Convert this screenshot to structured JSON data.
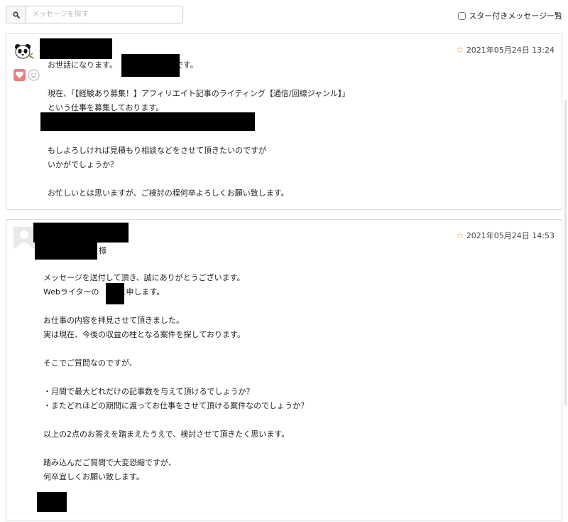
{
  "search": {
    "placeholder": "メッセージを探す"
  },
  "starred_filter": {
    "label": "スター付きメッセージ一覧"
  },
  "messages": [
    {
      "timestamp": "2021年05月24日 13:24",
      "greeting_prefix": "お世話になります。",
      "greeting_suffix": "です。",
      "lines": [
        "現在、「【経験あり募集！】アフィリエイト記事のライティング【通信/回線ジャンル】」",
        "という仕事を募集しております。",
        "",
        "",
        "もしよろしければ見積もり相談などをさせて頂きたいのですが",
        "いかがでしょうか？",
        "",
        "お忙しいとは思いますが、ご検討の程何卒よろしくお願い致します。"
      ]
    },
    {
      "timestamp": "2021年05月24日 14:53",
      "salutation_suffix": "様",
      "intro_line1": "メッセージを送付して頂き、誠にありがとうございます。",
      "intro_line2_prefix": "Webライターの",
      "intro_line2_suffix": "と申します。",
      "lines": [
        "",
        "お仕事の内容を拝見させて頂きました。",
        "実は現在、今後の収益の柱となる案件を探しております。",
        "",
        "そこでご質問なのですが、",
        "",
        "・月間で最大どれだけの記事数を与えて頂けるでしょうか？",
        "・またどれほどの期間に渡ってお仕事をさせて頂ける案件なのでしょうか？",
        "",
        "以上の2点のお答えを踏まえたうえで、検討させて頂きたく思います。",
        "",
        "踏み込んだご質問で大変恐縮ですが、",
        "何卒宜しくお願い致します。"
      ]
    }
  ]
}
